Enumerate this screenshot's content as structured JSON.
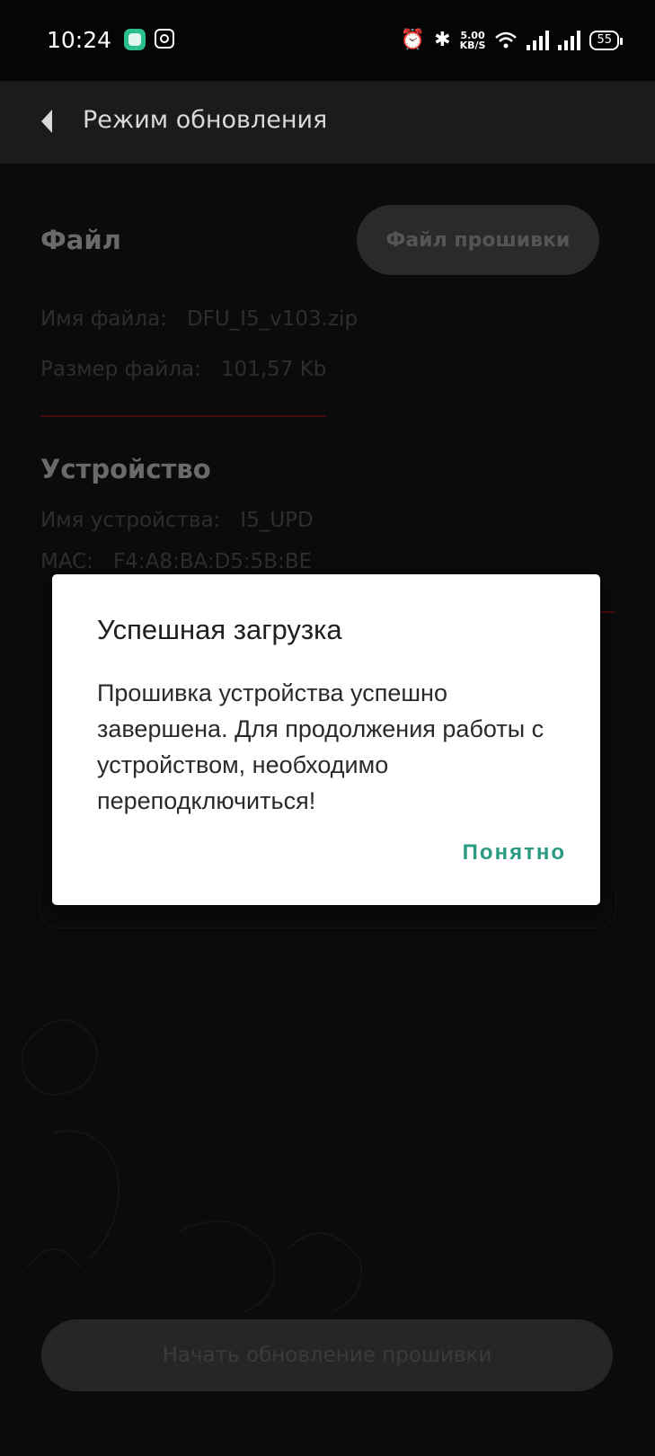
{
  "status_bar": {
    "time": "10:24",
    "net_speed_value": "5.00",
    "net_speed_unit": "KB/S",
    "battery": "55",
    "icons": [
      "app-notification-icon",
      "instagram-icon",
      "alarm-icon",
      "bluetooth-icon",
      "wifi-icon",
      "signal-icon",
      "signal-icon",
      "battery-icon"
    ]
  },
  "app_bar": {
    "back_icon": "back-arrow-icon",
    "title": "Режим обновления"
  },
  "file_section": {
    "title": "Файл",
    "button_label": "Файл прошивки",
    "name_label": "Имя файла:",
    "name_value": "DFU_I5_v103.zip",
    "size_label": "Размер файла:",
    "size_value": "101,57 Kb"
  },
  "device_section": {
    "title": "Устройство",
    "name_label": "Имя устройства:",
    "name_value": "I5_UPD",
    "mac_label": "MAC:",
    "mac_value": "F4:A8:BA:D5:5B:BE"
  },
  "start_button_label": "Начать обновление прошивки",
  "dialog": {
    "title": "Успешная загрузка",
    "message": "Прошивка устройства успешно завершена. Для продолжения работы с устройством, необходимо переподключиться!",
    "ok_label": "Понятно"
  },
  "colors": {
    "dialog_accent": "#2a9a82",
    "divider": "#4a0c0c",
    "background": "#0b0b0b"
  }
}
